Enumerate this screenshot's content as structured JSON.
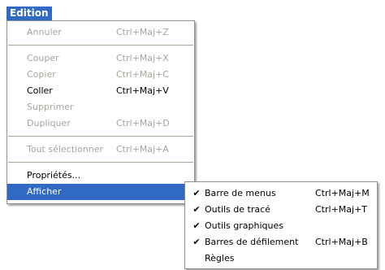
{
  "menubar": {
    "title": "Edition"
  },
  "main_menu": {
    "annuler": {
      "label": "Annuler",
      "shortcut": "Ctrl+Maj+Z"
    },
    "couper": {
      "label": "Couper",
      "shortcut": "Ctrl+Maj+X"
    },
    "copier": {
      "label": "Copier",
      "shortcut": "Ctrl+Maj+C"
    },
    "coller": {
      "label": "Coller",
      "shortcut": "Ctrl+Maj+V"
    },
    "supprimer": {
      "label": "Supprimer"
    },
    "dupliquer": {
      "label": "Dupliquer",
      "shortcut": "Ctrl+Maj+D"
    },
    "tout_selectionner": {
      "label": "Tout sélectionner",
      "shortcut": "Ctrl+Maj+A"
    },
    "proprietes": {
      "label": "Propriétés..."
    },
    "afficher": {
      "label": "Afficher"
    }
  },
  "sub_menu": {
    "barre_menus": {
      "label": "Barre de menus",
      "shortcut": "Ctrl+Maj+M",
      "checked": true
    },
    "outils_trace": {
      "label": "Outils de tracé",
      "shortcut": "Ctrl+Maj+T",
      "checked": true
    },
    "outils_graphiques": {
      "label": "Outils graphiques",
      "checked": true
    },
    "barres_defilement": {
      "label": "Barres de défilement",
      "shortcut": "Ctrl+Maj+B",
      "checked": true
    },
    "regles": {
      "label": "Règles",
      "checked": false
    }
  },
  "check_glyph": "✔",
  "colors": {
    "highlight": "#316ac5",
    "disabled": "#a7a69c"
  }
}
